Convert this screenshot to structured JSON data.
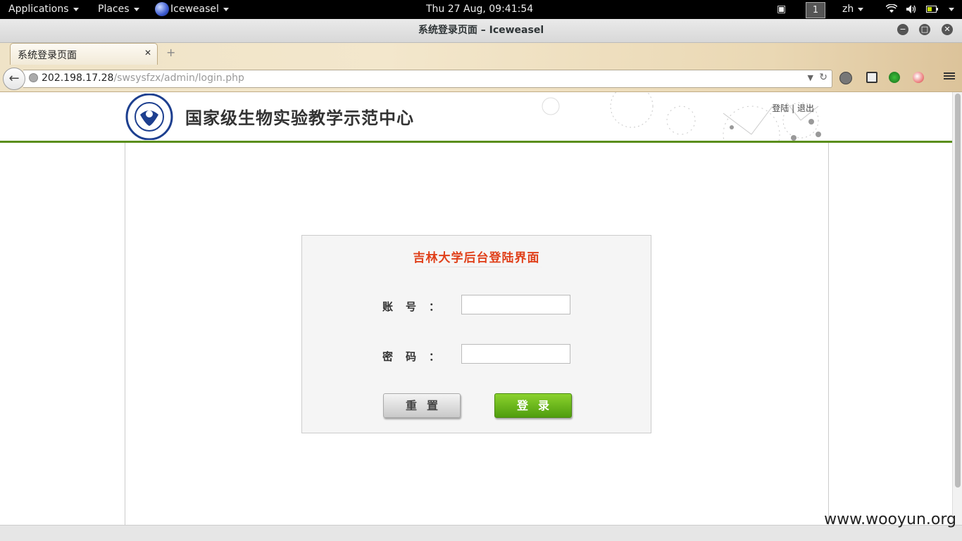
{
  "topbar": {
    "applications": "Applications",
    "places": "Places",
    "app_name": "Iceweasel",
    "clock": "Thu 27 Aug, 09:41:54",
    "workspace": "1",
    "language": "zh"
  },
  "window": {
    "title": "系统登录页面 – Iceweasel"
  },
  "browser": {
    "tab_label": "系统登录页面",
    "tab_close": "✕",
    "new_tab": "+",
    "url_host": "202.198.17.28",
    "url_path": "/swsysfzx/admin/login.php"
  },
  "site": {
    "title": "国家级生物实验教学示范中心",
    "link_login": "登陆",
    "link_sep": "|",
    "link_logout": "退出"
  },
  "login": {
    "title": "吉林大学后台登陆界面",
    "account_label": "账号",
    "password_label": "密码",
    "colon": "：",
    "account_value": "",
    "password_value": "",
    "reset_label": "重置",
    "login_label": "登录"
  },
  "colors": {
    "header_green": "#5a8e1b",
    "login_title": "#e0401a",
    "login_button": "#6cb81c"
  },
  "watermark": "www.wooyun.org"
}
